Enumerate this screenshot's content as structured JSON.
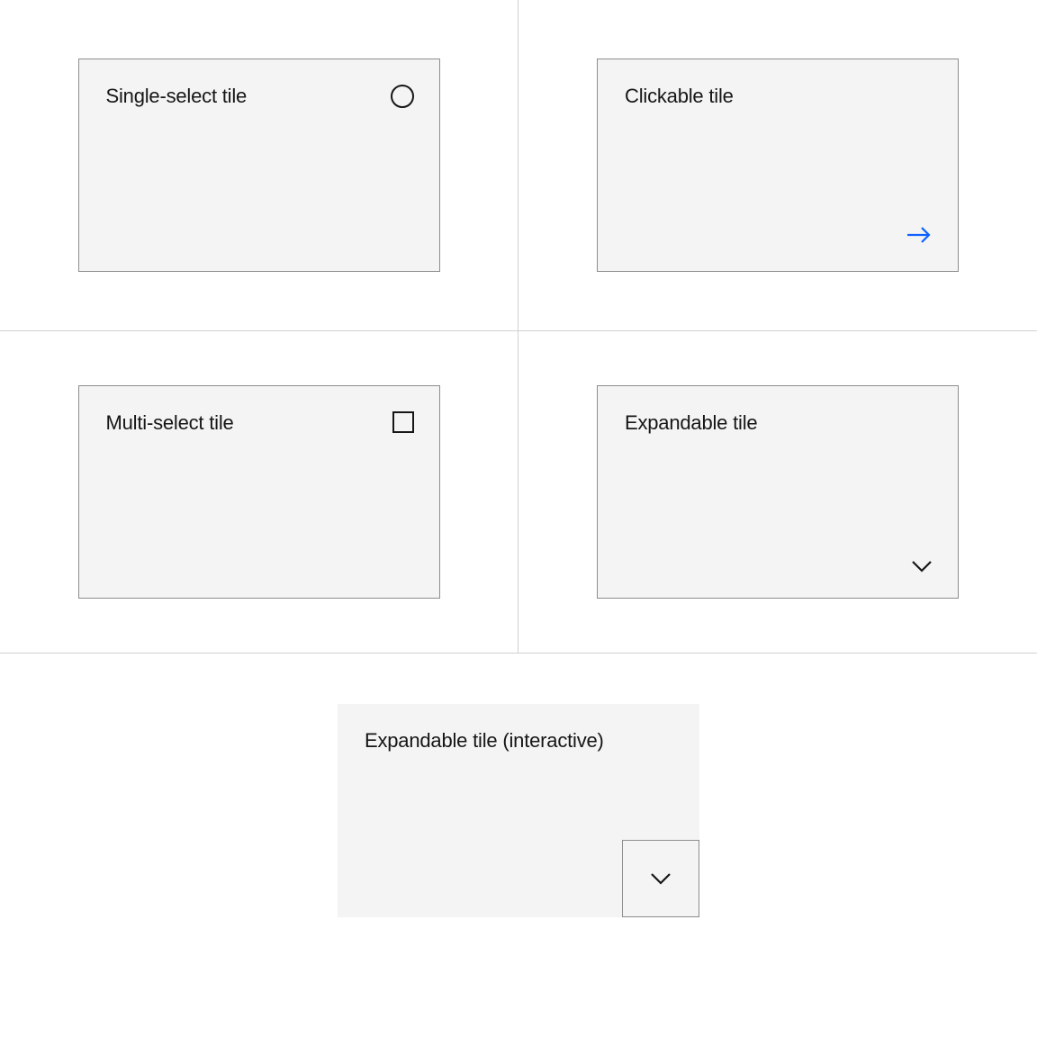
{
  "tiles": {
    "single_select": {
      "title": "Single-select tile"
    },
    "clickable": {
      "title": "Clickable tile"
    },
    "multi_select": {
      "title": "Multi-select tile"
    },
    "expandable": {
      "title": "Expandable tile"
    },
    "expandable_interactive": {
      "title": "Expandable tile (interactive)"
    }
  },
  "colors": {
    "tile_bg": "#f4f4f4",
    "tile_border": "#8d8d8d",
    "divider": "#d1d1d1",
    "text": "#161616",
    "accent": "#0f62fe"
  }
}
